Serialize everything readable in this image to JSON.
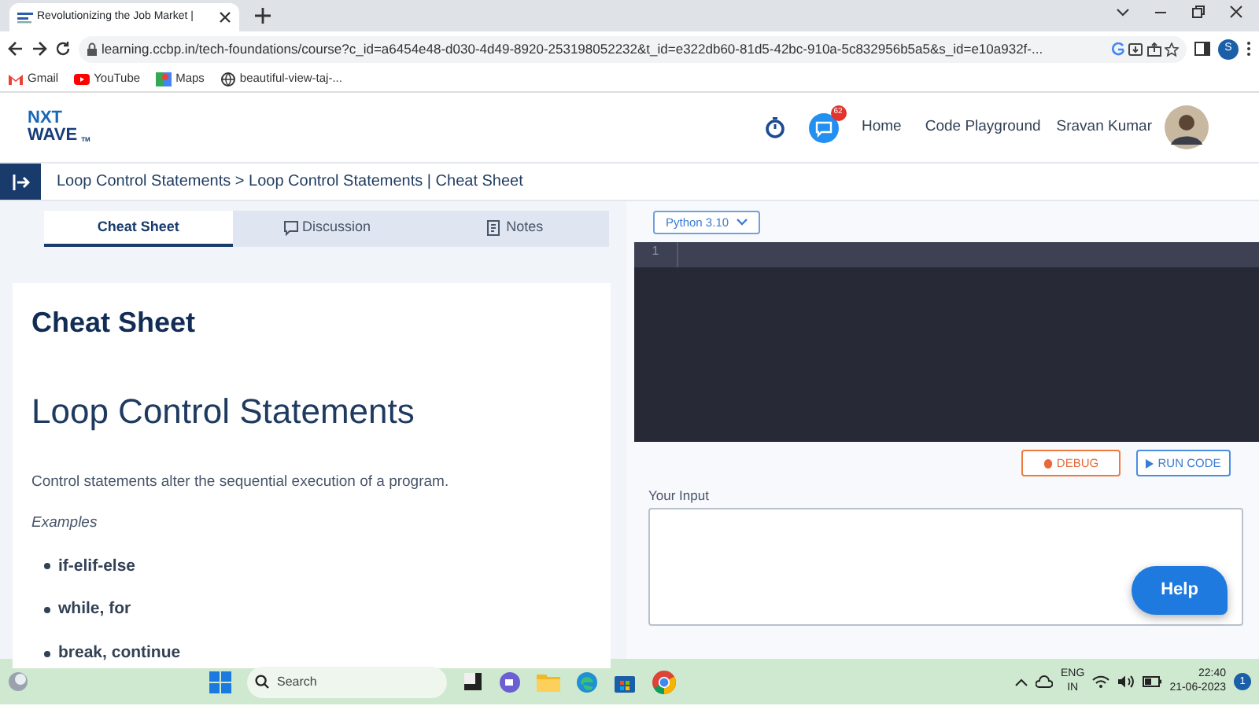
{
  "browser": {
    "tab_title": "Revolutionizing the Job Market |",
    "url": "learning.ccbp.in/tech-foundations/course?c_id=a6454e48-d030-4d49-8920-253198052232&t_id=e322db60-81d5-42bc-910a-5c832956b5a5&s_id=e10a932f-...",
    "bookmarks": [
      {
        "label": "Gmail",
        "kind": "mail"
      },
      {
        "label": "YouTube",
        "kind": "video"
      },
      {
        "label": "Maps",
        "kind": "maps"
      },
      {
        "label": "beautiful-view-taj-...",
        "kind": "web"
      }
    ],
    "profile_initial": "S"
  },
  "header": {
    "logo_top": "NXT",
    "logo_bottom": "WAVE",
    "logo_tm": "TM",
    "chat_badge": "62",
    "nav": [
      "Home",
      "Code Playground"
    ],
    "user_name": "Sravan Kumar"
  },
  "breadcrumb": "Loop Control Statements > Loop Control Statements | Cheat Sheet",
  "tabs": [
    {
      "label": "Cheat Sheet",
      "kind": "none",
      "selected": true
    },
    {
      "label": "Discussion",
      "kind": "chat",
      "selected": false
    },
    {
      "label": "Notes",
      "kind": "note",
      "selected": false
    }
  ],
  "cheat_sheet": {
    "title": "Cheat Sheet",
    "heading": "Loop Control Statements",
    "intro": "Control statements alter the sequential execution of a program.",
    "examples_label": "Examples",
    "examples": [
      "if-elif-else",
      "while, for",
      "break, continue"
    ]
  },
  "editor": {
    "language": "Python 3.10",
    "line_numbers": [
      "1"
    ]
  },
  "buttons": [
    {
      "label": "DEBUG",
      "kind": "debug"
    },
    {
      "label": "RUN CODE",
      "kind": "run"
    }
  ],
  "input": {
    "label": "Your Input"
  },
  "help": "Help",
  "taskbar": {
    "search_placeholder": "Search",
    "language": "ENG",
    "region": "IN",
    "time": "22:40",
    "date": "21-06-2023",
    "notifications": "1"
  }
}
